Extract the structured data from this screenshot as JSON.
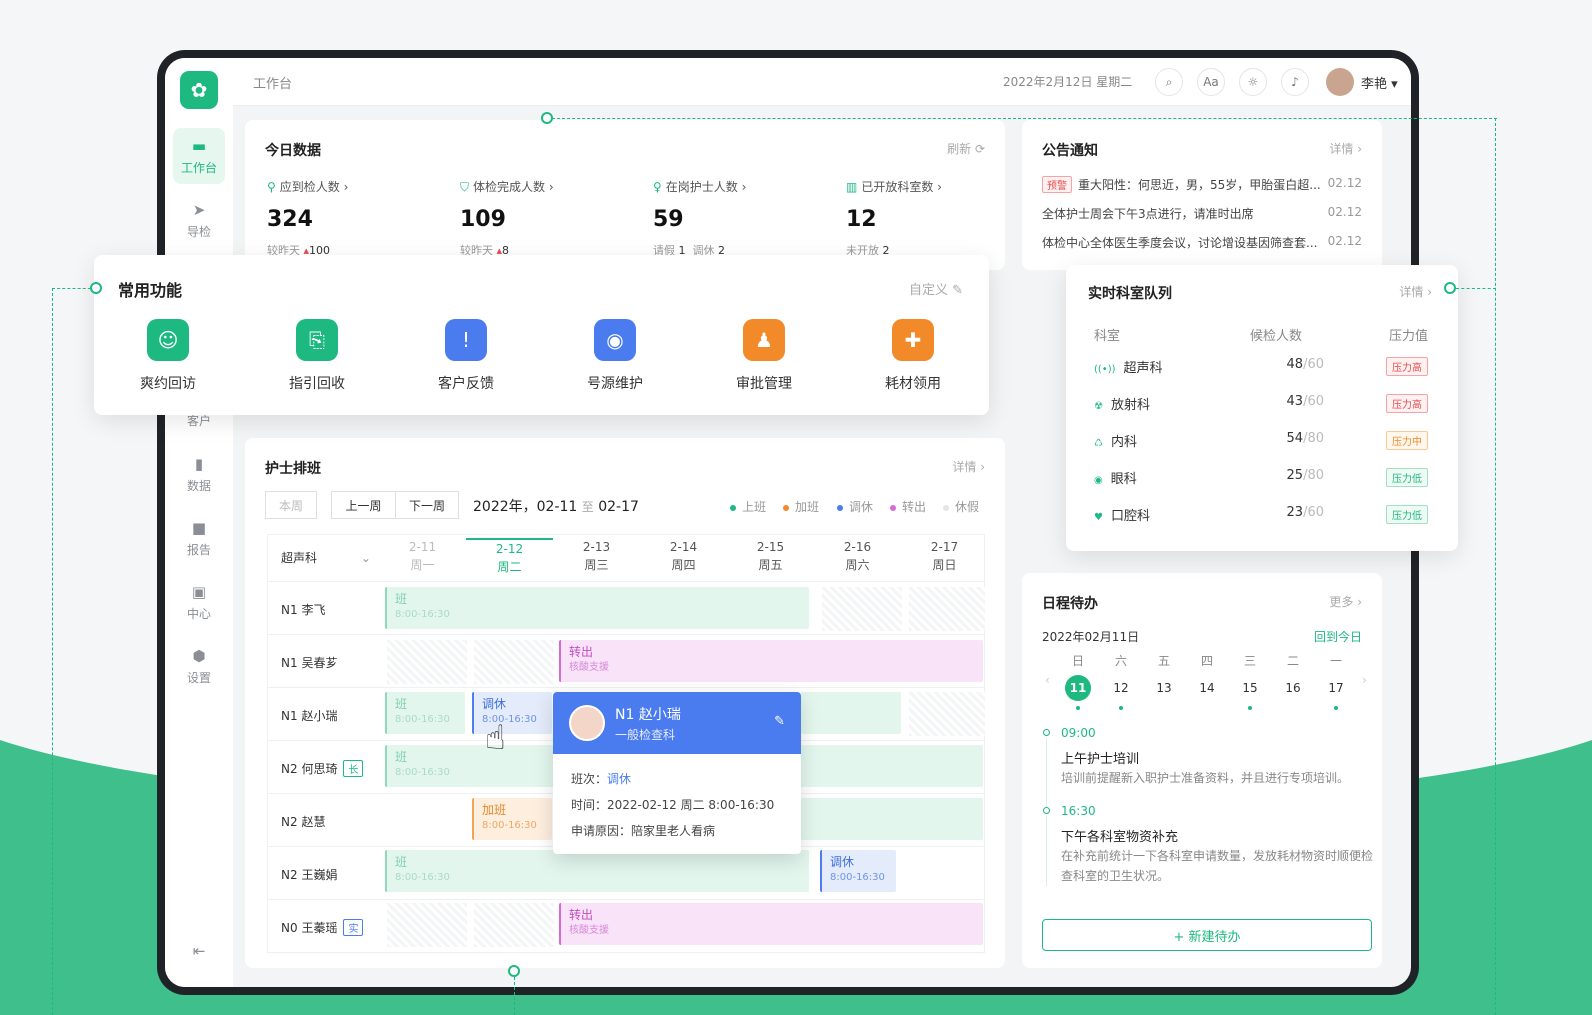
{
  "topbar": {
    "crumb": "工作台",
    "date": "2022年2月12日 星期二",
    "user": "李艳"
  },
  "nav": [
    "工作台",
    "导检",
    "客户",
    "数据",
    "报告",
    "中心",
    "设置"
  ],
  "today": {
    "title": "今日数据",
    "refresh": "刷新",
    "stats": [
      {
        "label": "应到检人数",
        "value": "324",
        "sub_label": "较昨天",
        "sub_value": "100"
      },
      {
        "label": "体检完成人数",
        "value": "109",
        "sub_label": "较昨天",
        "sub_value": "8"
      },
      {
        "label": "在岗护士人数",
        "value": "59",
        "sub_label": "请假",
        "sub_value": "1",
        "sub_label2": "调休",
        "sub_value2": "2"
      },
      {
        "label": "已开放科室数",
        "value": "12",
        "sub_label": "未开放",
        "sub_value": "2"
      }
    ]
  },
  "notice": {
    "title": "公告通知",
    "detail": "详情",
    "items": [
      {
        "tag": "预警",
        "text": "重大阳性：何思近，男，55岁，甲胎蛋白超...",
        "date": "02.12"
      },
      {
        "text": "全体护士周会下午3点进行，请准时出席",
        "date": "02.12"
      },
      {
        "text": "体检中心全体医生季度会议，讨论增设基因筛查套...",
        "date": "02.12"
      }
    ]
  },
  "functions": {
    "title": "常用功能",
    "customize": "自定义",
    "items": [
      {
        "label": "爽约回访",
        "color": "#1eb980"
      },
      {
        "label": "指引回收",
        "color": "#1eb980"
      },
      {
        "label": "客户反馈",
        "color": "#4a7cf0"
      },
      {
        "label": "号源维护",
        "color": "#4a7cf0"
      },
      {
        "label": "审批管理",
        "color": "#f28a2a"
      },
      {
        "label": "耗材领用",
        "color": "#f28a2a"
      }
    ]
  },
  "queue": {
    "title": "实时科室队列",
    "detail": "详情",
    "headers": [
      "科室",
      "候检人数",
      "压力值"
    ],
    "rows": [
      {
        "dept": "超声科",
        "count": "48",
        "total": "/60",
        "level": "压力高",
        "cls": "t-high"
      },
      {
        "dept": "放射科",
        "count": "43",
        "total": "/60",
        "level": "压力高",
        "cls": "t-high"
      },
      {
        "dept": "内科",
        "count": "54",
        "total": "/80",
        "level": "压力中",
        "cls": "t-mid"
      },
      {
        "dept": "眼科",
        "count": "25",
        "total": "/80",
        "level": "压力低",
        "cls": "t-low"
      },
      {
        "dept": "口腔科",
        "count": "23",
        "total": "/60",
        "level": "压力低",
        "cls": "t-low"
      }
    ]
  },
  "schedule": {
    "title": "护士排班",
    "detail": "详情",
    "this_week": "本周",
    "prev": "上一周",
    "next": "下一周",
    "range_start": "2022年，02-11",
    "range_sep": "至",
    "range_end": "02-17",
    "legend": [
      "上班",
      "加班",
      "调休",
      "转出",
      "休假"
    ],
    "dept": "超声科",
    "days": [
      {
        "date": "2-11",
        "week": "周一"
      },
      {
        "date": "2-12",
        "week": "周二"
      },
      {
        "date": "2-13",
        "week": "周三"
      },
      {
        "date": "2-14",
        "week": "周四"
      },
      {
        "date": "2-15",
        "week": "周五"
      },
      {
        "date": "2-16",
        "week": "周六"
      },
      {
        "date": "2-17",
        "week": "周日"
      }
    ],
    "nurses": [
      {
        "level": "N1",
        "name": "李飞"
      },
      {
        "level": "N1",
        "name": "吴春芗"
      },
      {
        "level": "N1",
        "name": "赵小瑞"
      },
      {
        "level": "N2",
        "name": "何思琦",
        "tag": "长"
      },
      {
        "level": "N2",
        "name": "赵慧"
      },
      {
        "level": "N2",
        "name": "王巍娟"
      },
      {
        "level": "N0",
        "name": "王蓁瑶",
        "tag": "实"
      }
    ],
    "shift_ban": "班",
    "shift_time": "8:00-16:30",
    "shift_out": "转出",
    "shift_out_sub": "核酸支援",
    "shift_rest": "调休",
    "shift_over": "加班"
  },
  "popup": {
    "name": "N1 赵小瑞",
    "dept": "一般检查科",
    "shift_label": "班次：",
    "shift_value": "调休",
    "time_label": "时间：",
    "time_value": "2022-02-12  周二  8:00-16:30",
    "reason_label": "申请原因：",
    "reason_value": "陪家里老人看病"
  },
  "todo": {
    "title": "日程待办",
    "more": "更多",
    "date": "2022年02月11日",
    "back_today": "回到今日",
    "weekdays": [
      "日",
      "六",
      "五",
      "四",
      "三",
      "二",
      "一"
    ],
    "days": [
      "11",
      "12",
      "13",
      "14",
      "15",
      "16",
      "17"
    ],
    "items": [
      {
        "time": "09:00",
        "title": "上午护士培训",
        "desc": "培训前提醒新入职护士准备资料，并且进行专项培训。"
      },
      {
        "time": "16:30",
        "title": "下午各科室物资补充",
        "desc": "在补充前统计一下各科室申请数量，发放耗材物资时顺便检查科室的卫生状况。"
      }
    ],
    "new_btn": "+ 新建待办"
  }
}
